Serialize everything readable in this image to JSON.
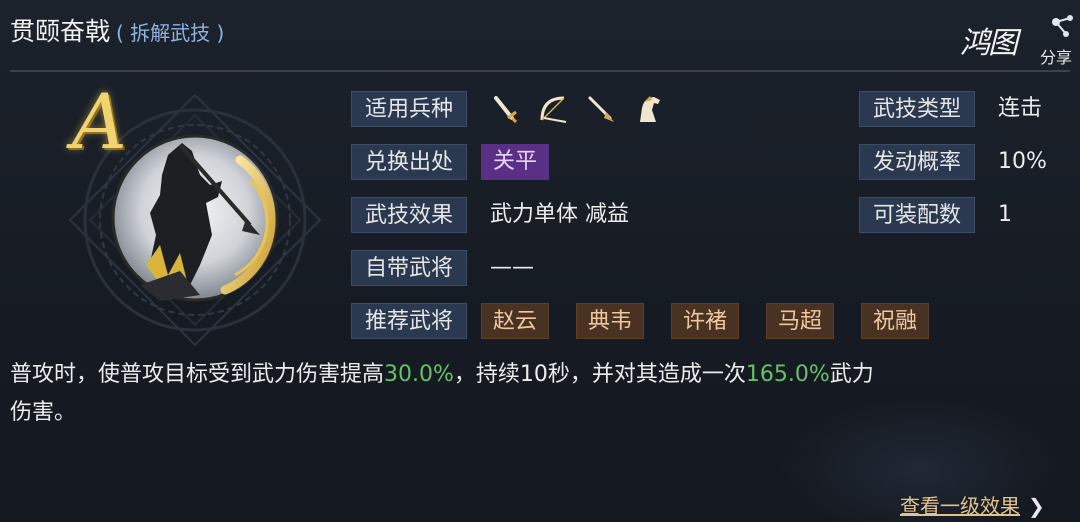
{
  "skill": {
    "name": "贯颐奋戟",
    "subtitle": "( 拆解武技 )",
    "grade": "A"
  },
  "logo": {
    "text": "鸿图",
    "sub": "分享"
  },
  "fields": {
    "troop_types_label": "适用兵种",
    "troop_icons": [
      "sword-icon",
      "bow-icon",
      "spear-icon",
      "horse-icon"
    ],
    "source_label": "兑换出处",
    "source_value": "关平",
    "effect_label": "武技效果",
    "effect_value": "武力单体 减益",
    "own_general_label": "自带武将",
    "own_general_value": "——",
    "recommended_label": "推荐武将",
    "recommended": [
      "赵云",
      "典韦",
      "许褚",
      "马超",
      "祝融"
    ],
    "type_label": "武技类型",
    "type_value": "连击",
    "trigger_label": "发动概率",
    "trigger_value": "10%",
    "equip_label": "可装配数",
    "equip_value": "1"
  },
  "description": {
    "part1": "普攻时，使普攻目标受到武力伤害提高",
    "hl1": "30.0%",
    "part2": "，持续10秒，并对其造成一次",
    "hl2": "165.0%",
    "part3": "武力",
    "part4": "伤害。"
  },
  "more_label": "查看一级效果",
  "colors": {
    "highlight": "#68c06a",
    "accent_gold": "#e2c48a",
    "label_bg": "#2b3950",
    "purple_tag": "#5a2f86",
    "brown_tag": "#4a3222"
  }
}
